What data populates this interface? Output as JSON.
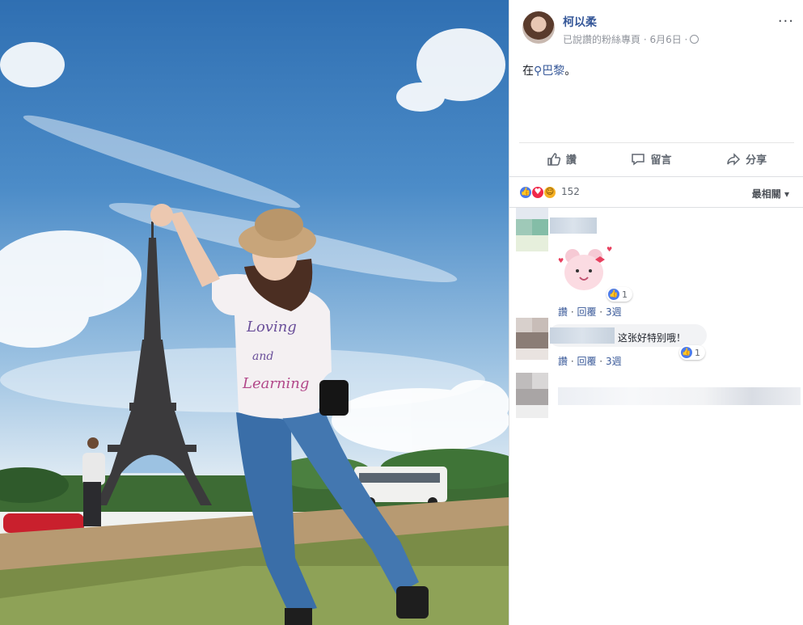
{
  "post": {
    "author": "柯以柔",
    "meta": "已說讚的粉絲專頁 · 6月6日 ·",
    "more_label": "···",
    "text_prefix": "在",
    "place": "巴黎",
    "text_suffix": "。"
  },
  "actions": {
    "like": "讚",
    "comment": "留言",
    "share": "分享"
  },
  "reactions": {
    "count": "152",
    "sort": "最相關"
  },
  "comments": [
    {
      "like_count": "1",
      "links": {
        "like": "讚",
        "reply": "回覆",
        "age": "3週"
      }
    },
    {
      "text": "这张好特别哦！",
      "like_count": "1",
      "links": {
        "like": "讚",
        "reply": "回覆",
        "age": "3週"
      }
    }
  ],
  "colors": {
    "link": "#365899",
    "muted": "#90949c",
    "like_blue": "#4b7bec",
    "love_red": "#f0284a"
  }
}
